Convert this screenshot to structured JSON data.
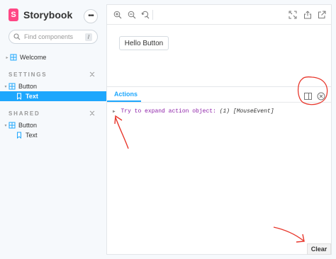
{
  "sidebar": {
    "brand": "Storybook",
    "brand_letter": "S",
    "more_label": "•••",
    "search_placeholder": "Find components",
    "search_shortcut": "/",
    "welcome": "Welcome",
    "sections": [
      {
        "title": "SETTINGS",
        "component": "Button",
        "story": "Text"
      },
      {
        "title": "SHARED",
        "component": "Button",
        "story": "Text"
      }
    ]
  },
  "preview": {
    "canvas_button_label": "Hello Button"
  },
  "addons": {
    "tab_label": "Actions",
    "log_text": "Try to expand action object:",
    "log_count": "(1)",
    "log_event": "[MouseEvent]",
    "clear_label": "Clear"
  },
  "colors": {
    "accent": "#1ea7fd",
    "brand": "#ff4785",
    "annotation": "#e8372c",
    "log_text": "#8c1ea7"
  }
}
